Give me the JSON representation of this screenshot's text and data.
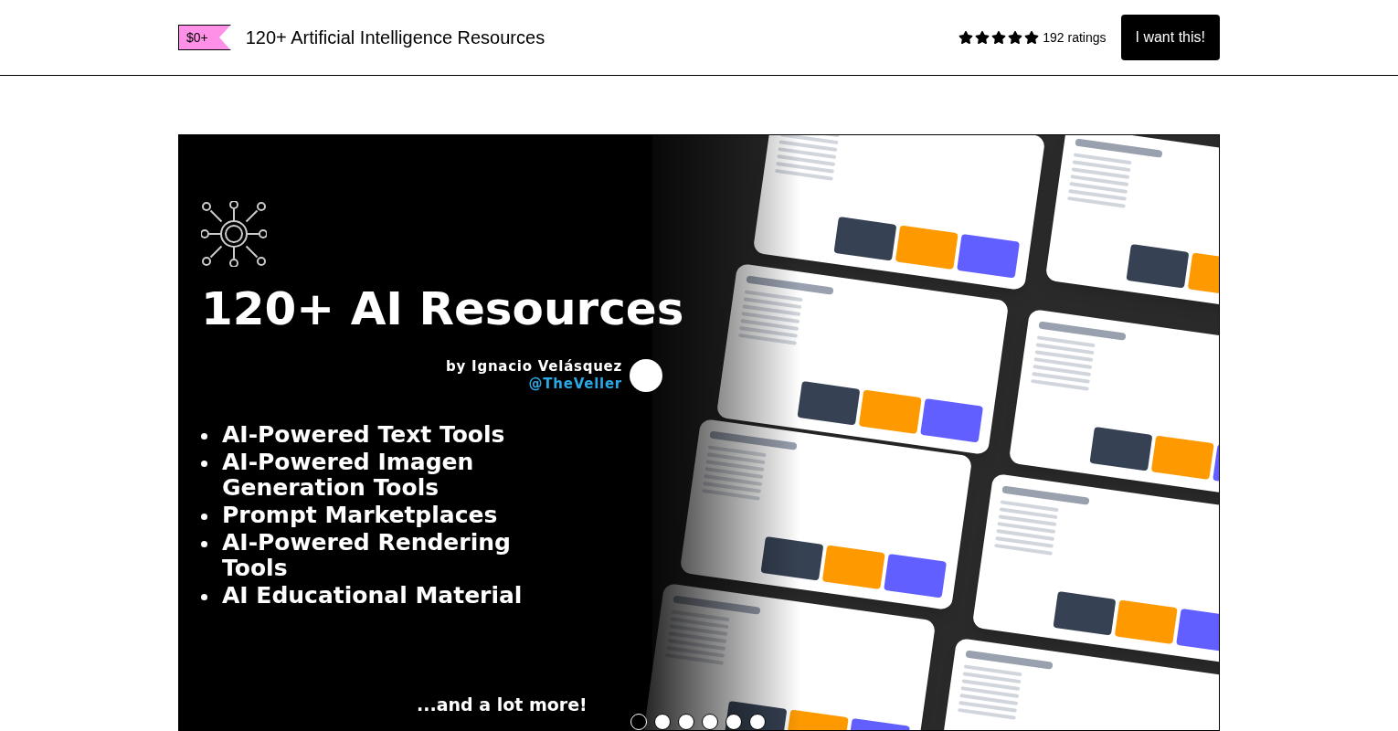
{
  "header": {
    "price": "$0+",
    "title": "120+ Artificial Intelligence Resources",
    "rating": {
      "stars": 5,
      "count": "192 ratings"
    },
    "button": "I want this!"
  },
  "cover": {
    "heading": "120+ AI Resources",
    "byline": "by Ignacio Velásquez",
    "handle": "@TheVeller",
    "bullets": [
      "AI-Powered Text Tools",
      "AI-Powered Imagen Generation Tools",
      "Prompt Marketplaces",
      "AI-Powered Rendering Tools",
      "AI Educational Material"
    ],
    "footer": "...and a lot more!"
  },
  "carousel": [
    {
      "selected": true
    },
    {
      "selected": false
    },
    {
      "selected": false
    },
    {
      "selected": false
    },
    {
      "selected": false
    },
    {
      "selected": false
    }
  ]
}
